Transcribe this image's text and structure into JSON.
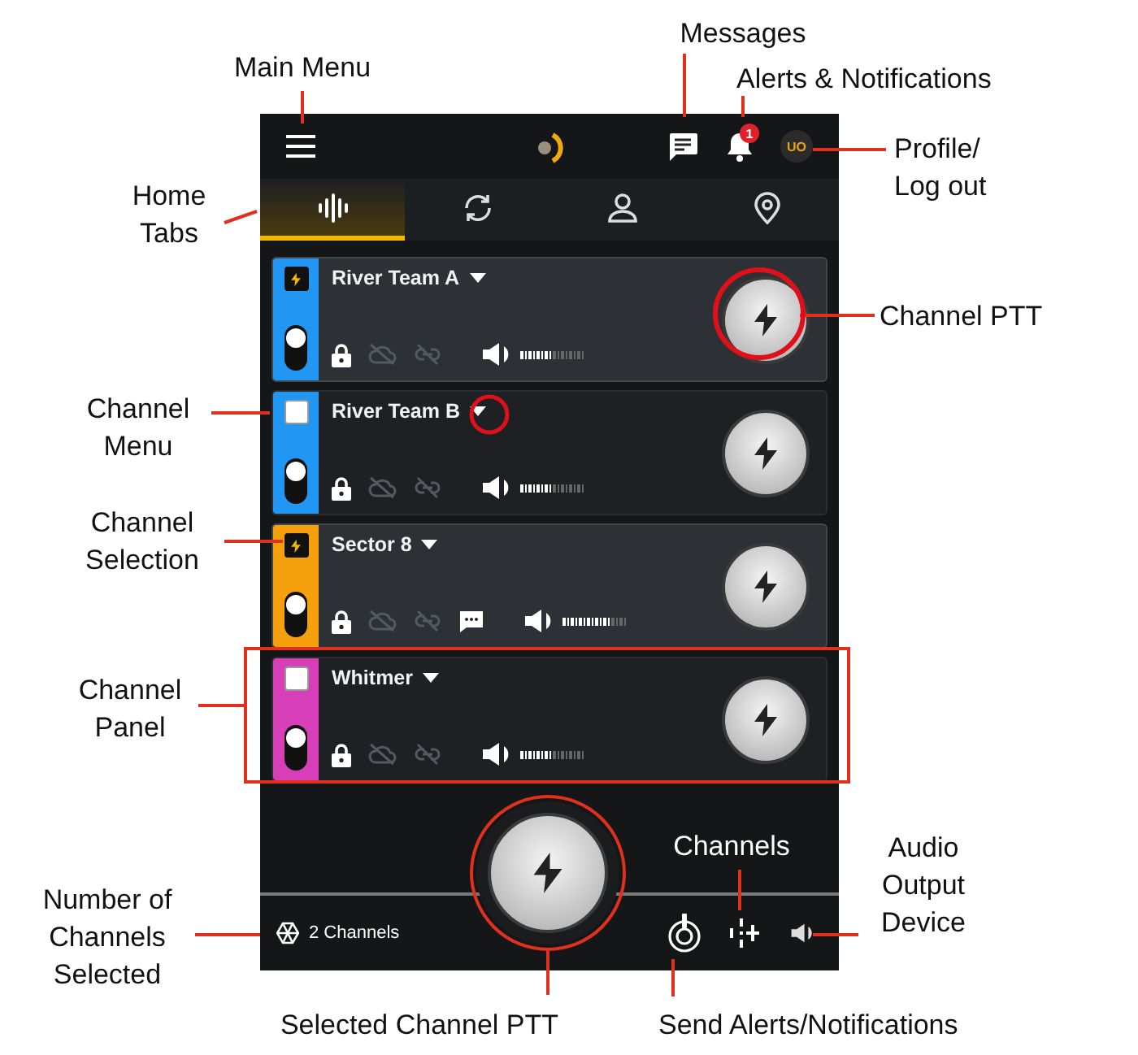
{
  "annotations": [
    "Main Menu",
    "Messages",
    "Alerts & Notifications",
    "Profile/\nLog out",
    "Home\nTabs",
    "Channel PTT",
    "Channel\nMenu",
    "Channel\nSelection",
    "Channel\nPanel",
    "Channels",
    "Audio\nOutput\nDevice",
    "Number of\nChannels\nSelected",
    "Selected Channel PTT",
    "Send Alerts/Notifications"
  ],
  "header": {
    "alert_count": "1",
    "avatar": "UO"
  },
  "tabs": [
    {
      "kind": "voice",
      "selected": true
    },
    {
      "kind": "sync",
      "selected": false
    },
    {
      "kind": "person",
      "selected": false
    },
    {
      "kind": "location",
      "selected": false
    }
  ],
  "channels": [
    {
      "name": "River Team A",
      "color": "#2196f3",
      "selected": true,
      "has_message": false,
      "level": 0.5
    },
    {
      "name": "River Team B",
      "color": "#2196f3",
      "selected": false,
      "has_message": false,
      "level": 0.5
    },
    {
      "name": "Sector 8",
      "color": "#f5a00c",
      "selected": true,
      "has_message": true,
      "level": 0.75
    },
    {
      "name": "Whitmer",
      "color": "#d63fb8",
      "selected": false,
      "has_message": false,
      "level": 0.5
    }
  ],
  "footer": {
    "channel_count": "2 Channels"
  }
}
